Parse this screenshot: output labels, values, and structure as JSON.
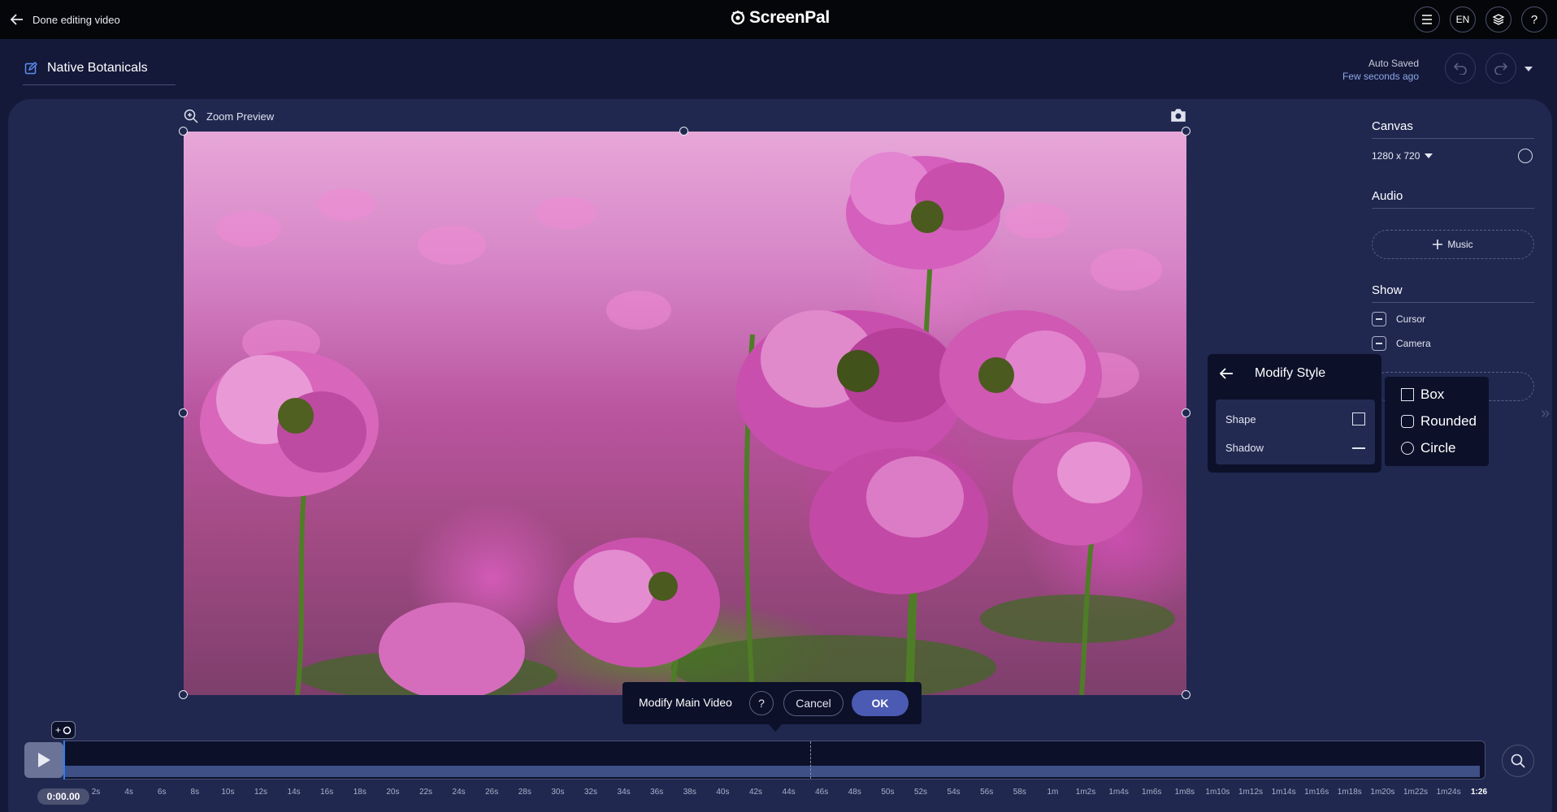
{
  "header": {
    "back_label": "Done editing video",
    "logo_text_1": "Screen",
    "logo_text_2": "Pal",
    "language": "EN",
    "help": "?"
  },
  "project": {
    "title": "Native Botanicals",
    "autosave_label": "Auto Saved",
    "autosave_time": "Few seconds ago"
  },
  "preview": {
    "zoom_label": "Zoom Preview"
  },
  "sidebar": {
    "canvas_heading": "Canvas",
    "canvas_size": "1280 x 720",
    "audio_heading": "Audio",
    "music_label": "Music",
    "show_heading": "Show",
    "show_items": [
      {
        "label": "Cursor"
      },
      {
        "label": "Camera"
      }
    ]
  },
  "modify_style": {
    "title": "Modify Style",
    "rows": [
      {
        "label": "Shape"
      },
      {
        "label": "Shadow"
      }
    ],
    "shape_options": [
      {
        "label": "Box",
        "icon": "square-icon"
      },
      {
        "label": "Rounded",
        "icon": "rounded-square-icon"
      },
      {
        "label": "Circle",
        "icon": "circle-icon"
      }
    ]
  },
  "modify_bar": {
    "label": "Modify Main Video",
    "help": "?",
    "cancel": "Cancel",
    "ok": "OK"
  },
  "timeline": {
    "current_time": "0:00.00",
    "add_marker": "+",
    "ticks": [
      "2s",
      "4s",
      "6s",
      "8s",
      "10s",
      "12s",
      "14s",
      "16s",
      "18s",
      "20s",
      "22s",
      "24s",
      "26s",
      "28s",
      "30s",
      "32s",
      "34s",
      "36s",
      "38s",
      "40s",
      "42s",
      "44s",
      "46s",
      "48s",
      "50s",
      "52s",
      "54s",
      "56s",
      "58s",
      "1m",
      "1m2s",
      "1m4s",
      "1m6s",
      "1m8s",
      "1m10s",
      "1m12s",
      "1m14s",
      "1m16s",
      "1m18s",
      "1m20s",
      "1m22s",
      "1m24s"
    ],
    "end_time": "1:26"
  },
  "colors": {
    "background": "#14193a",
    "panel": "#202850",
    "topbar": "#050609",
    "popover": "#0c1029",
    "accent": "#4b5ab2",
    "playhead": "#2d7ef3"
  }
}
